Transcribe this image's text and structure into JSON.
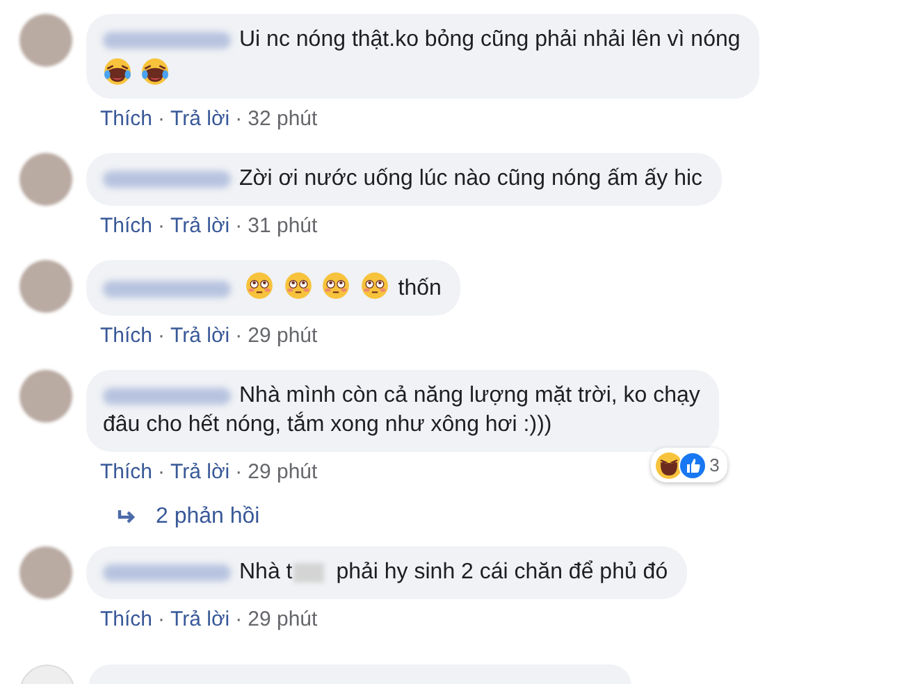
{
  "comments": [
    {
      "text": "Ui nc nóng thật.ko bỏng cũng phải nhải lên vì nóng",
      "emojis": [
        {
          "kind": "laugh-cry"
        },
        {
          "kind": "laugh-cry"
        }
      ],
      "actions": {
        "like": "Thích",
        "separator": "·",
        "reply": "Trả lời",
        "time": "32 phút"
      }
    },
    {
      "text": "Zời ơi nước uống lúc nào cũng nóng ấm ấy hic",
      "actions": {
        "like": "Thích",
        "separator": "·",
        "reply": "Trả lời",
        "time": "31 phút"
      }
    },
    {
      "emojis": [
        {
          "kind": "flushed"
        },
        {
          "kind": "flushed"
        },
        {
          "kind": "flushed"
        },
        {
          "kind": "flushed"
        }
      ],
      "text_after": "thốn",
      "actions": {
        "like": "Thích",
        "separator": "·",
        "reply": "Trả lời",
        "time": "29 phút"
      }
    },
    {
      "lines": [
        "Nhà mình còn cả năng lượng mặt trời, ko chạy",
        "đâu cho hết nóng, tắm xong như xông hơi :)))"
      ],
      "reactions": {
        "count": "3"
      },
      "actions": {
        "like": "Thích",
        "separator": "·",
        "reply": "Trả lời",
        "time": "29 phút"
      },
      "replies": "2 phản hồi"
    },
    {
      "text": "Nhà t",
      "censored": true,
      "text_after": "phải hy sinh 2 cái chăn để phủ đó",
      "actions": {
        "like": "Thích",
        "separator": "·",
        "reply": "Trả lời",
        "time": "29 phút"
      }
    }
  ]
}
